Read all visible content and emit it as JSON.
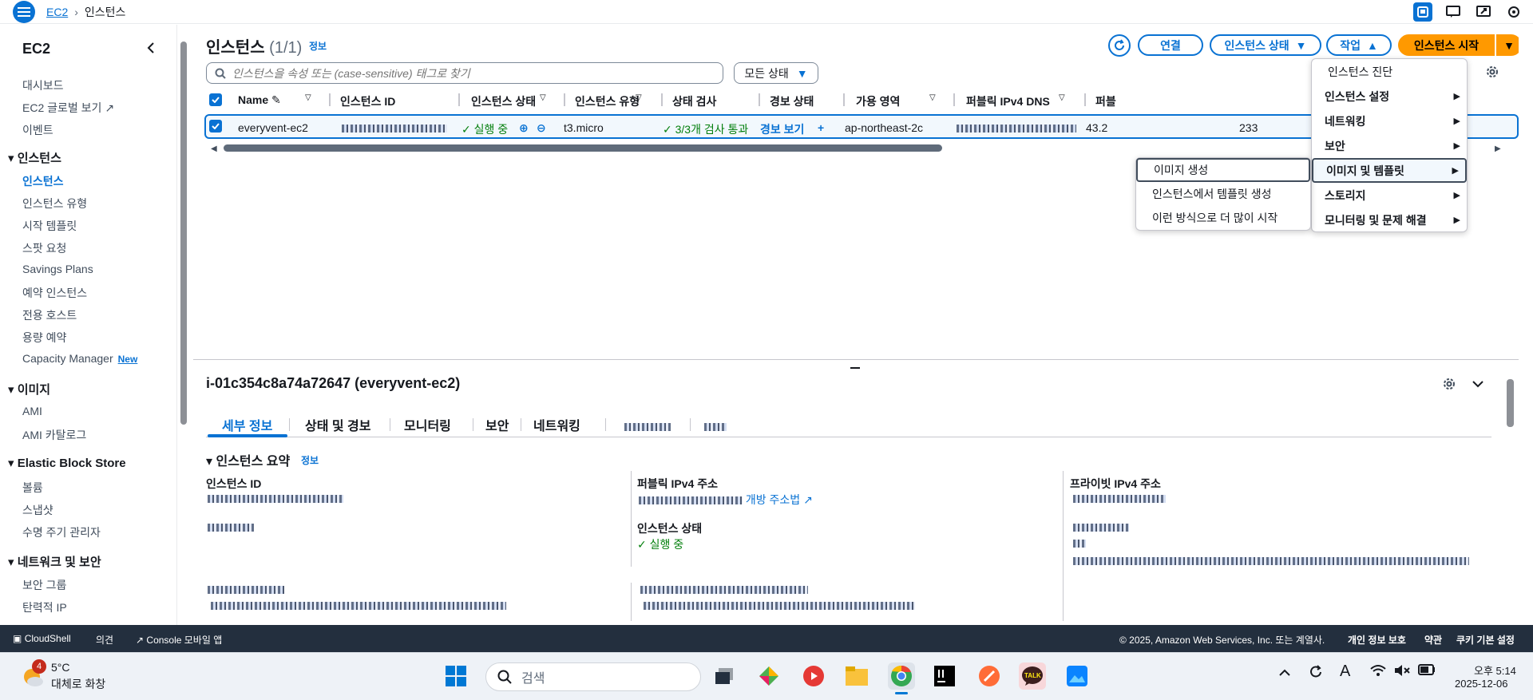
{
  "breadcrumb": {
    "root": "EC2",
    "current": "인스턴스"
  },
  "sidebar": {
    "title": "EC2",
    "top_items": [
      "대시보드",
      "EC2 글로벌 보기",
      "이벤트"
    ],
    "sections": [
      {
        "label": "인스턴스",
        "items": [
          "인스턴스",
          "인스턴스 유형",
          "시작 템플릿",
          "스팟 요청",
          "Savings Plans",
          "예약 인스턴스",
          "전용 호스트",
          "용량 예약",
          "Capacity Manager"
        ]
      },
      {
        "label": "이미지",
        "items": [
          "AMI",
          "AMI 카탈로그"
        ]
      },
      {
        "label": "Elastic Block Store",
        "items": [
          "볼륨",
          "스냅샷",
          "수명 주기 관리자"
        ]
      },
      {
        "label": "네트워크 및 보안",
        "items": [
          "보안 그룹",
          "탄력적 IP"
        ]
      }
    ],
    "new_badge": "New",
    "active_item": "인스턴스"
  },
  "main": {
    "title": "인스턴스",
    "count": "(1/1)",
    "info": "정보",
    "search_placeholder": "인스턴스을 속성 또는 (case-sensitive) 태그로 찾기",
    "state_filter": "모든 상태",
    "buttons": {
      "connect": "연결",
      "instance_state": "인스턴스 상태",
      "actions": "작업",
      "launch": "인스턴스 시작"
    }
  },
  "table": {
    "columns": [
      "Name",
      "인스턴스 ID",
      "인스턴스 상태",
      "인스턴스 유형",
      "상태 검사",
      "경보 상태",
      "가용 영역",
      "퍼블릭 IPv4 DNS",
      "퍼블"
    ],
    "row": {
      "name": "everyvent-ec2",
      "state": "실행 중",
      "type": "t3.micro",
      "status_check": "3/3개 검사 통과",
      "alarm": "경보 보기",
      "az": "ap-northeast-2c",
      "public_ip_partial": "43.2",
      "trailing": "233"
    }
  },
  "actions_menu": {
    "items": [
      "인스턴스 진단",
      "인스턴스 설정",
      "네트워킹",
      "보안",
      "이미지 및 템플릿",
      "스토리지",
      "모니터링 및 문제 해결"
    ],
    "highlighted": "이미지 및 템플릿"
  },
  "sub_menu": {
    "items": [
      "이미지 생성",
      "인스턴스에서 템플릿 생성",
      "이런 방식으로 더 많이 시작"
    ],
    "highlighted": "이미지 생성"
  },
  "details": {
    "title": "i-01c354c8a74a72647 (everyvent-ec2)",
    "tabs": [
      "세부 정보",
      "상태 및 경보",
      "모니터링",
      "보안",
      "네트워킹"
    ],
    "summary_title": "인스턴스 요약",
    "summary_info": "정보",
    "labels": {
      "instance_id": "인스턴스 ID",
      "public_ipv4": "퍼블릭 IPv4 주소",
      "private_ipv4": "프라이빗 IPv4 주소",
      "instance_state": "인스턴스 상태"
    },
    "open_address": "개방 주소법",
    "state_value": "실행 중"
  },
  "footer": {
    "left": [
      "CloudShell",
      "의견",
      "Console 모바일 앱"
    ],
    "copyright": "© 2025, Amazon Web Services, Inc. 또는 계열사.",
    "right": [
      "개인 정보 보호",
      "약관",
      "쿠키 기본 설정"
    ]
  },
  "taskbar": {
    "weather_badge": "4",
    "temp": "5°C",
    "weather_desc": "대체로 화창",
    "search": "검색",
    "time": "오후 5:14",
    "date": "2025-12-06",
    "kakao_label": "TALK"
  },
  "colors": {
    "accent": "#0972d3",
    "primary_btn": "#ff9900",
    "footer_bg": "#232f3e",
    "success": "#037f0c"
  }
}
